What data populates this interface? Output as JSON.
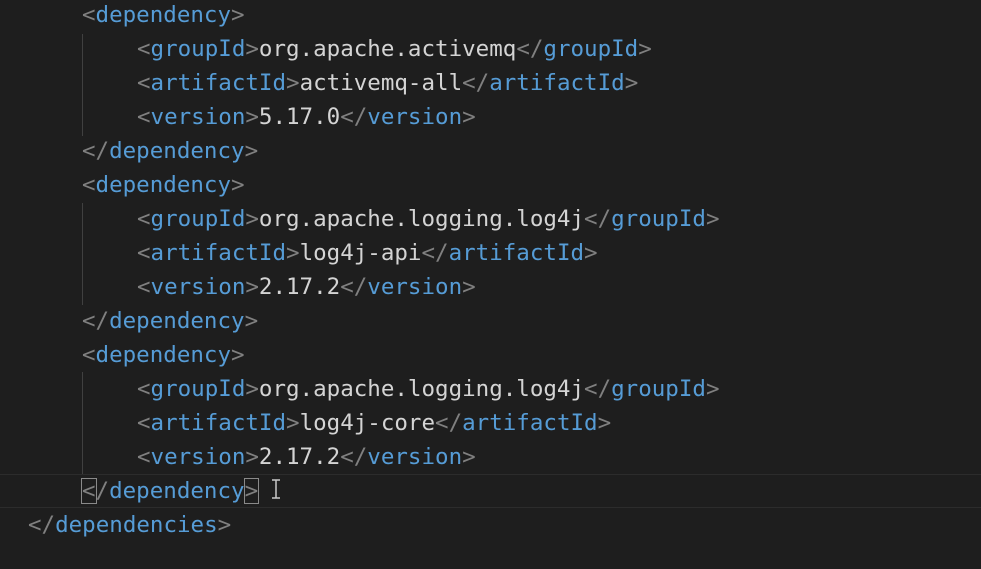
{
  "lines": [
    {
      "indent": 1,
      "kind": "open",
      "tag": "dependency"
    },
    {
      "indent": 2,
      "kind": "element",
      "tag": "groupId",
      "text": "org.apache.activemq"
    },
    {
      "indent": 2,
      "kind": "element",
      "tag": "artifactId",
      "text": "activemq-all"
    },
    {
      "indent": 2,
      "kind": "element",
      "tag": "version",
      "text": "5.17.0"
    },
    {
      "indent": 1,
      "kind": "close",
      "tag": "dependency"
    },
    {
      "indent": 1,
      "kind": "open",
      "tag": "dependency"
    },
    {
      "indent": 2,
      "kind": "element",
      "tag": "groupId",
      "text": "org.apache.logging.log4j"
    },
    {
      "indent": 2,
      "kind": "element",
      "tag": "artifactId",
      "text": "log4j-api"
    },
    {
      "indent": 2,
      "kind": "element",
      "tag": "version",
      "text": "2.17.2"
    },
    {
      "indent": 1,
      "kind": "close",
      "tag": "dependency"
    },
    {
      "indent": 1,
      "kind": "open",
      "tag": "dependency"
    },
    {
      "indent": 2,
      "kind": "element",
      "tag": "groupId",
      "text": "org.apache.logging.log4j"
    },
    {
      "indent": 2,
      "kind": "element",
      "tag": "artifactId",
      "text": "log4j-core"
    },
    {
      "indent": 2,
      "kind": "element",
      "tag": "version",
      "text": "2.17.2"
    },
    {
      "indent": 1,
      "kind": "close",
      "tag": "dependency",
      "current": true,
      "bracket_match": true
    },
    {
      "indent": 0,
      "kind": "close",
      "tag": "dependencies"
    }
  ],
  "colors": {
    "background": "#1e1e1e",
    "tag": "#569cd6",
    "punctuation": "#808080",
    "text": "#d4d4d4"
  },
  "cursor": {
    "icon": "text-cursor-icon"
  }
}
